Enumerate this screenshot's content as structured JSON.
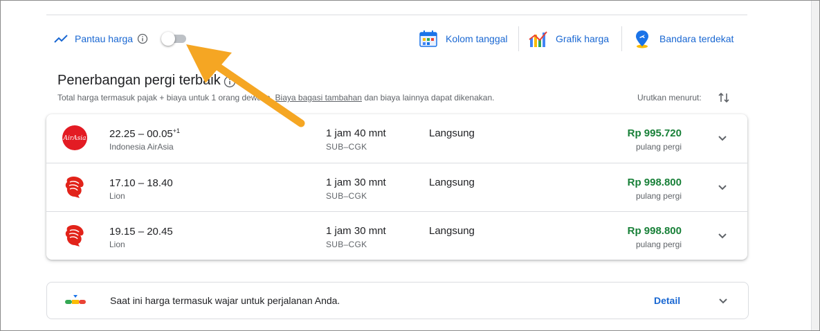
{
  "toolbar": {
    "track_label": "Pantau harga",
    "tools": [
      {
        "label": "Kolom tanggal",
        "icon": "calendar-grid-icon"
      },
      {
        "label": "Grafik harga",
        "icon": "price-graph-icon"
      },
      {
        "label": "Bandara terdekat",
        "icon": "airport-pin-icon"
      }
    ]
  },
  "section": {
    "title": "Penerbangan pergi terbaik",
    "note_before": "Total harga termasuk pajak + biaya untuk 1 orang dewasa.",
    "note_link": "Biaya bagasi tambahan",
    "note_after": "dan biaya lainnya dapat dikenakan.",
    "sort_label": "Urutkan menurut:"
  },
  "flights": [
    {
      "times": "22.25 – 00.05",
      "day_offset": "+1",
      "airline": "Indonesia AirAsia",
      "duration": "1 jam 40 mnt",
      "route": "SUB–CGK",
      "stops": "Langsung",
      "price": "Rp 995.720",
      "price_type": "pulang pergi",
      "logo": "airasia-logo"
    },
    {
      "times": "17.10 – 18.40",
      "day_offset": "",
      "airline": "Lion",
      "duration": "1 jam 30 mnt",
      "route": "SUB–CGK",
      "stops": "Langsung",
      "price": "Rp 998.800",
      "price_type": "pulang pergi",
      "logo": "lion-air-logo"
    },
    {
      "times": "19.15 – 20.45",
      "day_offset": "",
      "airline": "Lion",
      "duration": "1 jam 30 mnt",
      "route": "SUB–CGK",
      "stops": "Langsung",
      "price": "Rp 998.800",
      "price_type": "pulang pergi",
      "logo": "lion-air-logo"
    }
  ],
  "insight": {
    "text": "Saat ini harga termasuk wajar untuk perjalanan Anda.",
    "detail_label": "Detail"
  },
  "colors": {
    "accent_blue": "#1967d2",
    "price_green": "#188038",
    "annotation_orange": "#f5a623",
    "airasia_red": "#e31b23",
    "lion_red": "#e2231a"
  }
}
